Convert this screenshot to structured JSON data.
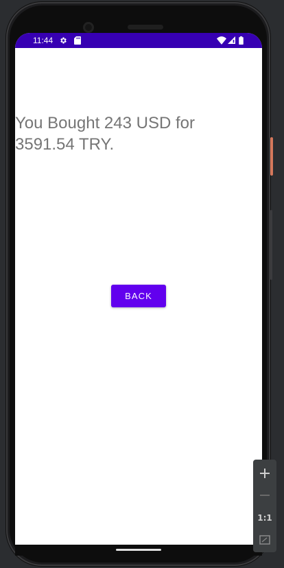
{
  "status_bar": {
    "time": "11:44",
    "icons": [
      "gear-icon",
      "sd-card-icon",
      "wifi-icon",
      "signal-icon",
      "battery-icon"
    ],
    "background_color": "#3700b3"
  },
  "main": {
    "result_text": "You Bought 243 USD for 3591.54 TRY.",
    "back_button_label": "BACK",
    "accent_color": "#6200ee"
  },
  "emulator_toolbar": {
    "zoom_in_icon": "plus-icon",
    "zoom_out_icon": "minus-icon",
    "one_to_one_label": "1:1",
    "fit_screen_icon": "fit-screen-icon"
  }
}
